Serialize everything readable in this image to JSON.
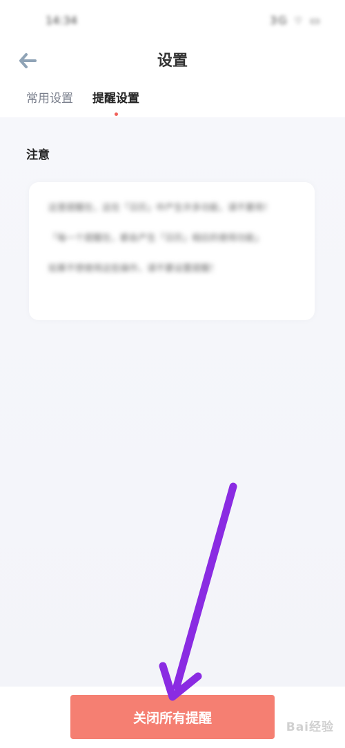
{
  "status_bar": {
    "time": "14:34",
    "icons": "3G ⌔ ▭"
  },
  "header": {
    "title": "设置",
    "back_icon": "arrow-left-icon"
  },
  "tabs": [
    {
      "label": "常用设置",
      "active": false
    },
    {
      "label": "提醒设置",
      "active": true
    }
  ],
  "notice": {
    "title": "注意",
    "paragraphs": [
      "这里提醒在，这在「日历」中产生许多功能，请不要用！",
      "「每一个提醒在，都会产生「日历」相应的使用功能」",
      "如果不想使用这些操作，请不要设置提醒！"
    ]
  },
  "actions": {
    "close_all_label": "关闭所有提醒"
  },
  "annotation": {
    "arrow_color": "#8a2be2"
  },
  "watermark": {
    "text": "Bai经验"
  },
  "colors": {
    "accent": "#f57f72",
    "indicator": "#f0605a"
  }
}
